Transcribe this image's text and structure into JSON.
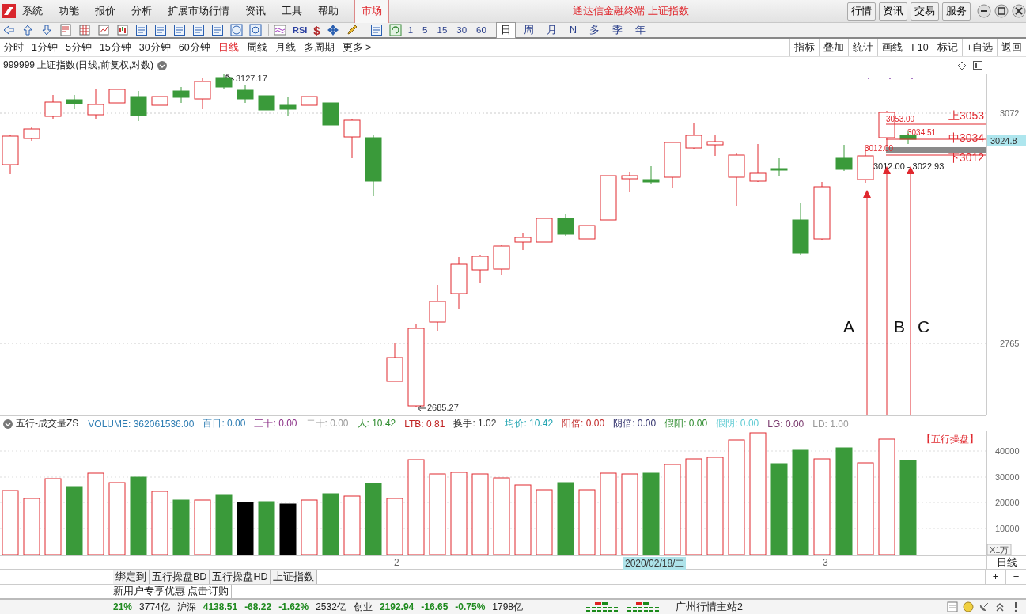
{
  "title_bar": {
    "menu": [
      "系统",
      "功能",
      "报价",
      "分析",
      "扩展市场行情",
      "资讯",
      "工具",
      "帮助"
    ],
    "market_tab": "市场",
    "title": "通达信金融终端 上证指数",
    "buttons": [
      "行情",
      "资讯",
      "交易",
      "服务"
    ]
  },
  "toolbar": {
    "rsi": "RSI",
    "dollar": "$",
    "intervals": [
      "1",
      "5",
      "15",
      "30",
      "60"
    ],
    "periods": [
      {
        "label": "日",
        "selected": true
      },
      {
        "label": "周",
        "selected": false
      },
      {
        "label": "月",
        "selected": false
      },
      {
        "label": "N",
        "selected": false
      },
      {
        "label": "多",
        "selected": false
      },
      {
        "label": "季",
        "selected": false
      },
      {
        "label": "年",
        "selected": false
      }
    ]
  },
  "period_bar": {
    "items": [
      {
        "label": "分时",
        "selected": false
      },
      {
        "label": "1分钟",
        "selected": false
      },
      {
        "label": "5分钟",
        "selected": false
      },
      {
        "label": "15分钟",
        "selected": false
      },
      {
        "label": "30分钟",
        "selected": false
      },
      {
        "label": "60分钟",
        "selected": false
      },
      {
        "label": "日线",
        "selected": true
      },
      {
        "label": "周线",
        "selected": false
      },
      {
        "label": "月线",
        "selected": false
      },
      {
        "label": "多周期",
        "selected": false
      },
      {
        "label": "更多 >",
        "selected": false
      }
    ],
    "tools": [
      "指标",
      "叠加",
      "统计",
      "画线",
      "F10",
      "标记",
      "+自选",
      "返回"
    ]
  },
  "chart": {
    "title": "999999 上证指数(日线,前复权,对数)",
    "high_label": "3127.17",
    "low_label": "2685.27",
    "price_axis": [
      {
        "label": "3072",
        "kind": "tick"
      },
      {
        "label": "3024.8",
        "kind": "current"
      },
      {
        "label": "2765",
        "kind": "tick"
      }
    ],
    "levels": [
      "上3053",
      "中3034",
      "下3012"
    ],
    "price_tags": [
      "3053.00",
      "3034.51",
      "3012.00",
      "3012.00 - 3022.93"
    ],
    "markers": [
      "A",
      "B",
      "C"
    ]
  },
  "indicator": {
    "name": "五行-成交量ZS",
    "values": [
      {
        "label": "VOLUME: 362061536.00",
        "color": "#2e7db3"
      },
      {
        "label": "百日: 0.00",
        "color": "#2e7db3"
      },
      {
        "label": "三十: 0.00",
        "color": "#8a2f86"
      },
      {
        "label": "二十: 0.00",
        "color": "#9a9a9a"
      },
      {
        "label": "人: 10.42",
        "color": "#2e8b2e"
      },
      {
        "label": "LTB: 0.81",
        "color": "#c02424"
      },
      {
        "label": "换手: 1.02",
        "color": "#333333"
      },
      {
        "label": "均价: 10.42",
        "color": "#1fa3b0"
      },
      {
        "label": "阳倍: 0.00",
        "color": "#c02424"
      },
      {
        "label": "阴倍: 0.00",
        "color": "#33336e"
      },
      {
        "label": "假阳: 0.00",
        "color": "#2e8b2e"
      },
      {
        "label": "假阴: 0.00",
        "color": "#5fcbd3"
      },
      {
        "label": "LG: 0.00",
        "color": "#7a3a6e"
      },
      {
        "label": "LD: 1.00",
        "color": "#9a9a9a"
      }
    ],
    "badge": "【五行操盘】",
    "axis": [
      "40000",
      "30000",
      "20000",
      "10000"
    ],
    "unit": "X1万"
  },
  "date_axis": {
    "labels": [
      {
        "label": "2",
        "kind": "tick"
      },
      {
        "label": "2020/02/18/二",
        "kind": "cursor"
      },
      {
        "label": "3",
        "kind": "tick"
      }
    ],
    "period": "日线"
  },
  "tabs": [
    {
      "label": "绑定到",
      "selected": false
    },
    {
      "label": "五行操盘BD",
      "selected": false
    },
    {
      "label": "五行操盘HD",
      "selected": false
    },
    {
      "label": "上证指数",
      "selected": false
    }
  ],
  "zoom_buttons": [
    "+",
    "−"
  ],
  "promo": "新用户专享优惠 点击订购",
  "status_bar": {
    "items": [
      {
        "text": "21%",
        "kind": "down"
      },
      {
        "text": "3774亿",
        "kind": "plain"
      },
      {
        "text": "沪深",
        "kind": "plain"
      },
      {
        "text": "4138.51",
        "kind": "down"
      },
      {
        "text": "-68.22",
        "kind": "down"
      },
      {
        "text": "-1.62%",
        "kind": "down"
      },
      {
        "text": "2532亿",
        "kind": "plain"
      },
      {
        "text": "创业",
        "kind": "plain"
      },
      {
        "text": "2192.94",
        "kind": "down"
      },
      {
        "text": "-16.65",
        "kind": "down"
      },
      {
        "text": "-0.75%",
        "kind": "down"
      },
      {
        "text": "1798亿",
        "kind": "plain"
      }
    ],
    "server": "广州行情主站2"
  }
}
